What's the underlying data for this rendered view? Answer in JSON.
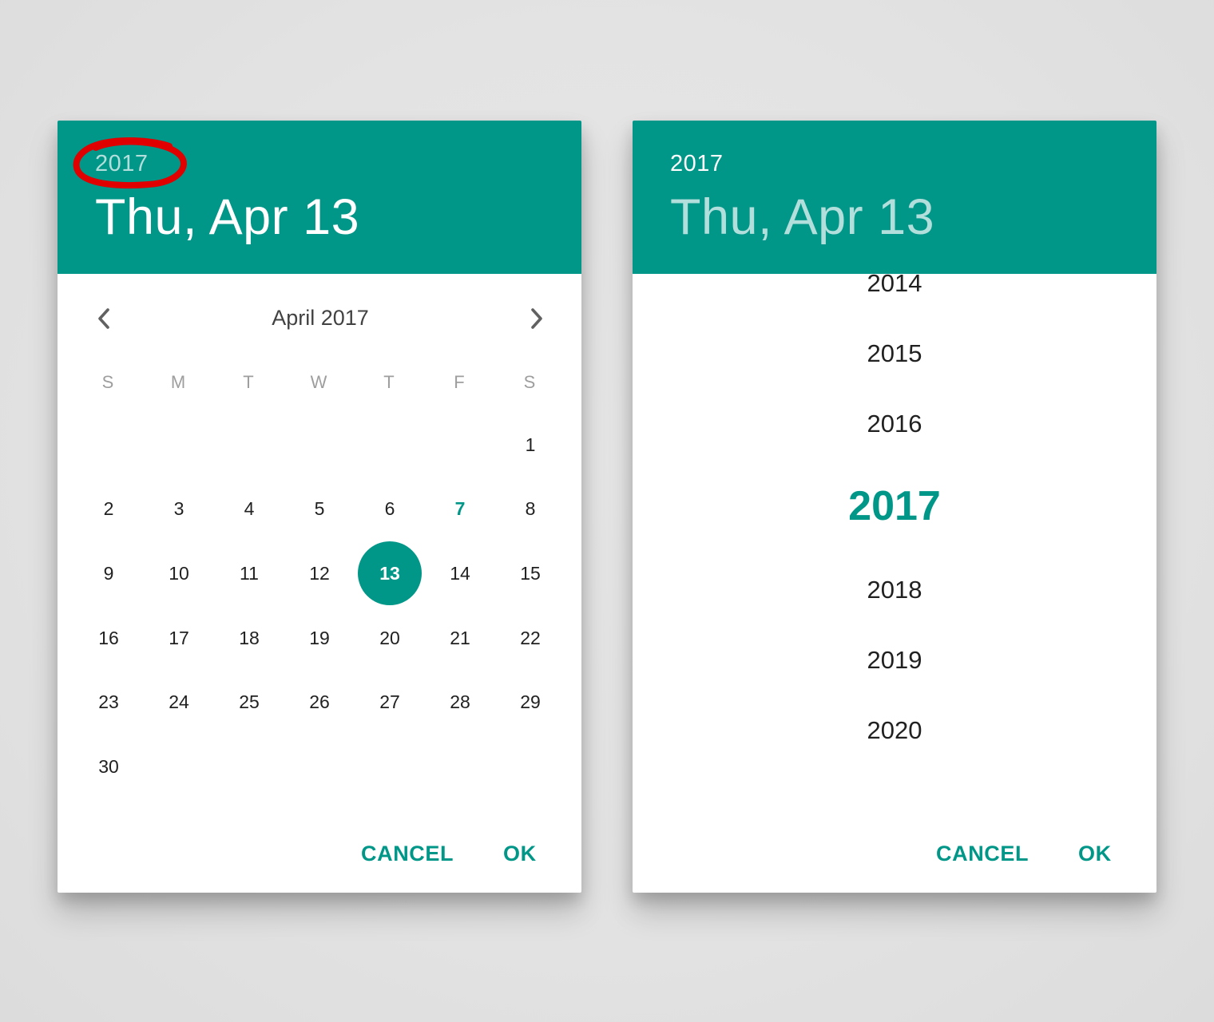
{
  "colors": {
    "accent": "#009688",
    "header_faint_text": "#b2dfdb",
    "annotation": "#e00000"
  },
  "calendar_dialog": {
    "header": {
      "year": "2017",
      "date": "Thu, Apr 13"
    },
    "annotation": "red-circle-around-year",
    "nav": {
      "prev_icon": "chevron-left-icon",
      "next_icon": "chevron-right-icon",
      "month_title": "April 2017"
    },
    "weekdays": [
      "S",
      "M",
      "T",
      "W",
      "T",
      "F",
      "S"
    ],
    "days": [
      "",
      "",
      "",
      "",
      "",
      "",
      "1",
      "2",
      "3",
      "4",
      "5",
      "6",
      "7",
      "8",
      "9",
      "10",
      "11",
      "12",
      "13",
      "14",
      "15",
      "16",
      "17",
      "18",
      "19",
      "20",
      "21",
      "22",
      "23",
      "24",
      "25",
      "26",
      "27",
      "28",
      "29",
      "30",
      "",
      "",
      "",
      "",
      "",
      ""
    ],
    "today": "7",
    "selected": "13",
    "actions": {
      "cancel": "CANCEL",
      "ok": "OK"
    }
  },
  "year_dialog": {
    "header": {
      "year": "2017",
      "date": "Thu, Apr 13"
    },
    "years": [
      "2014",
      "2015",
      "2016",
      "2017",
      "2018",
      "2019",
      "2020"
    ],
    "selected_year": "2017",
    "actions": {
      "cancel": "CANCEL",
      "ok": "OK"
    }
  }
}
